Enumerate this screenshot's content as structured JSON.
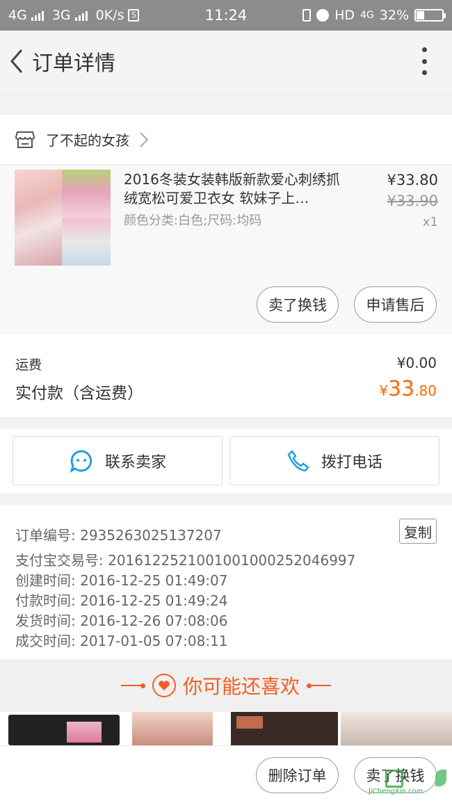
{
  "status_bar": {
    "network1": "4G",
    "network2": "3G",
    "speed": "0K/s",
    "time": "11:24",
    "hd": "HD",
    "network3": "4G",
    "battery": "32%"
  },
  "header": {
    "title": "订单详情"
  },
  "shop": {
    "name": "了不起的女孩"
  },
  "product": {
    "title": "2016冬装女装韩版新款爱心刺绣抓绒宽松可爱卫衣女 软妹子上…",
    "attributes": "颜色分类:白色;尺码:均码",
    "price": "¥33.80",
    "original_price": "¥33.90",
    "quantity": "x1",
    "sell_button": "卖了换钱",
    "aftersale_button": "申请售后"
  },
  "fees": {
    "shipping_label": "运费",
    "shipping_value": "¥0.00",
    "paid_label": "实付款（含运费）",
    "paid_currency": "¥",
    "paid_integer": "33",
    "paid_decimal": ".80",
    "accent_color": "#ff6600"
  },
  "contact": {
    "seller_button": "联系卖家",
    "call_button": "拨打电话"
  },
  "order_info": {
    "copy_button": "复制",
    "rows": [
      "订单编号: 2935263025137207",
      "支付宝交易号: 2016122521001001000252046997",
      "创建时间: 2016-12-25 01:49:07",
      "付款时间: 2016-12-25 01:49:24",
      "发货时间: 2016-12-26 07:08:06",
      "成交时间: 2017-01-05 07:08:11"
    ]
  },
  "recommend": {
    "title": "你可能还喜欢"
  },
  "bottom": {
    "delete_button": "删除订单",
    "sell_button": "卖了换钱"
  },
  "watermark": {
    "text": "JiChengXin.com"
  }
}
